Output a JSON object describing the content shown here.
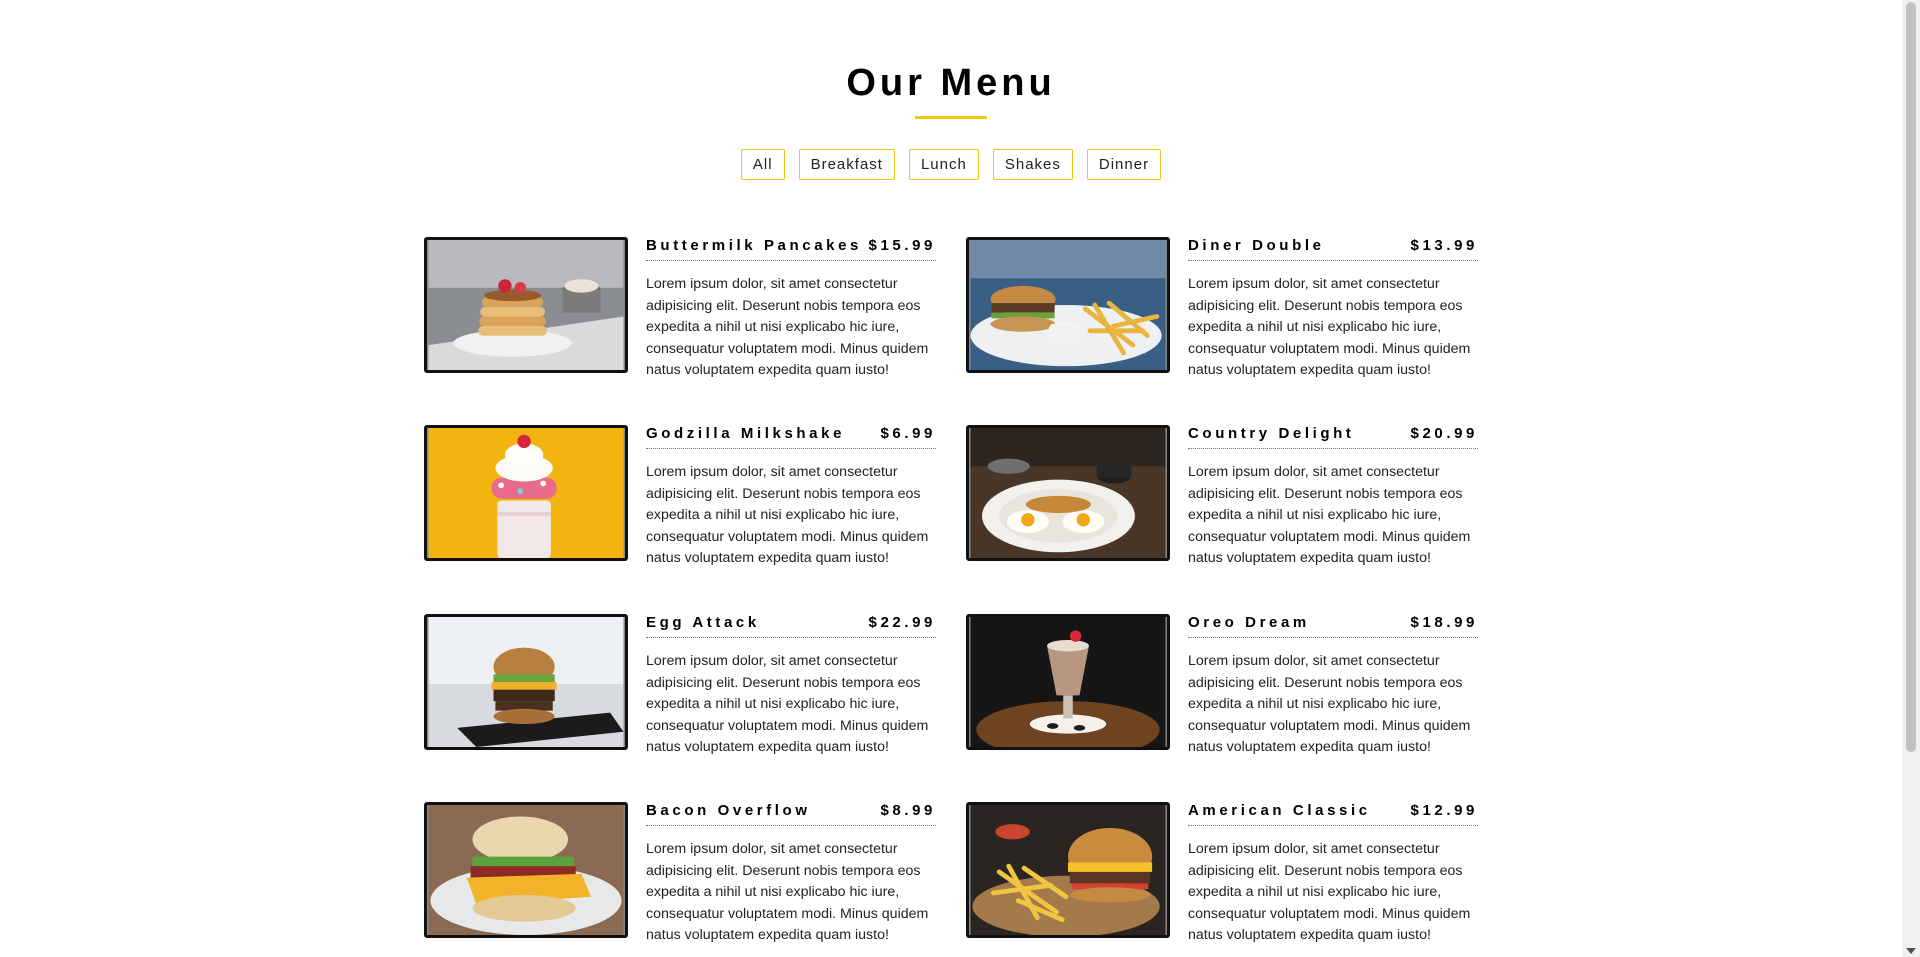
{
  "menu": {
    "title": "Our Menu",
    "filters": [
      "All",
      "Breakfast",
      "Lunch",
      "Shakes",
      "Dinner"
    ],
    "items": [
      {
        "name": "Buttermilk Pancakes",
        "price": "$15.99",
        "desc": "Lorem ipsum dolor, sit amet consectetur adipisicing elit. Deserunt nobis tempora eos expedita a nihil ut nisi explicabo hic iure, consequatur voluptatem modi. Minus quidem natus voluptatem expedita quam iusto!"
      },
      {
        "name": "Diner Double",
        "price": "$13.99",
        "desc": "Lorem ipsum dolor, sit amet consectetur adipisicing elit. Deserunt nobis tempora eos expedita a nihil ut nisi explicabo hic iure, consequatur voluptatem modi. Minus quidem natus voluptatem expedita quam iusto!"
      },
      {
        "name": "Godzilla Milkshake",
        "price": "$6.99",
        "desc": "Lorem ipsum dolor, sit amet consectetur adipisicing elit. Deserunt nobis tempora eos expedita a nihil ut nisi explicabo hic iure, consequatur voluptatem modi. Minus quidem natus voluptatem expedita quam iusto!"
      },
      {
        "name": "Country Delight",
        "price": "$20.99",
        "desc": "Lorem ipsum dolor, sit amet consectetur adipisicing elit. Deserunt nobis tempora eos expedita a nihil ut nisi explicabo hic iure, consequatur voluptatem modi. Minus quidem natus voluptatem expedita quam iusto!"
      },
      {
        "name": "Egg Attack",
        "price": "$22.99",
        "desc": "Lorem ipsum dolor, sit amet consectetur adipisicing elit. Deserunt nobis tempora eos expedita a nihil ut nisi explicabo hic iure, consequatur voluptatem modi. Minus quidem natus voluptatem expedita quam iusto!"
      },
      {
        "name": "Oreo Dream",
        "price": "$18.99",
        "desc": "Lorem ipsum dolor, sit amet consectetur adipisicing elit. Deserunt nobis tempora eos expedita a nihil ut nisi explicabo hic iure, consequatur voluptatem modi. Minus quidem natus voluptatem expedita quam iusto!"
      },
      {
        "name": "Bacon Overflow",
        "price": "$8.99",
        "desc": "Lorem ipsum dolor, sit amet consectetur adipisicing elit. Deserunt nobis tempora eos expedita a nihil ut nisi explicabo hic iure, consequatur voluptatem modi. Minus quidem natus voluptatem expedita quam iusto!"
      },
      {
        "name": "American Classic",
        "price": "$12.99",
        "desc": "Lorem ipsum dolor, sit amet consectetur adipisicing elit. Deserunt nobis tempora eos expedita a nihil ut nisi explicabo hic iure, consequatur voluptatem modi. Minus quidem natus voluptatem expedita quam iusto!"
      }
    ]
  },
  "colors": {
    "accent": "#f2c511",
    "text": "#222222",
    "frame": "#111111"
  },
  "icons": {
    "scroll_down": "chevron-down-icon"
  }
}
